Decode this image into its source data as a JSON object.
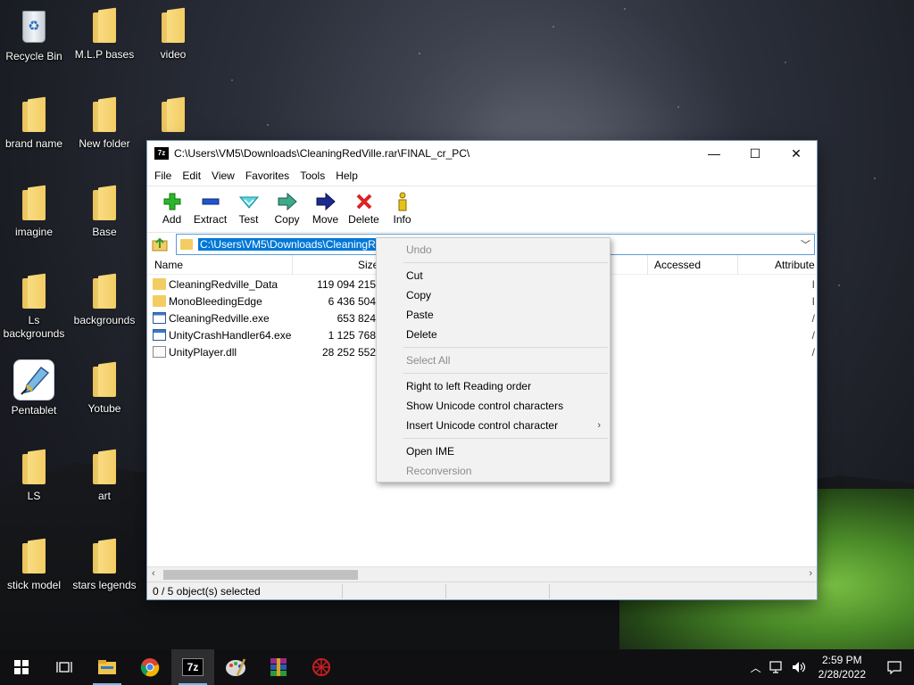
{
  "desktop": {
    "icons": [
      {
        "label": "Recycle Bin"
      },
      {
        "label": "M.L.P bases"
      },
      {
        "label": "video"
      },
      {
        "label": "brand name"
      },
      {
        "label": "New folder"
      },
      {
        "label": ""
      },
      {
        "label": "imagine"
      },
      {
        "label": "Base"
      },
      {
        "label": "Ls backgrounds"
      },
      {
        "label": "backgrounds"
      },
      {
        "label": "Pentablet"
      },
      {
        "label": "Yotube"
      },
      {
        "label": "LS"
      },
      {
        "label": "art"
      },
      {
        "label": "stick  model"
      },
      {
        "label": "stars legends"
      }
    ]
  },
  "window": {
    "title": "C:\\Users\\VM5\\Downloads\\CleaningRedVille.rar\\FINAL_cr_PC\\",
    "app_icon_text": "7z",
    "controls": {
      "minimize": "—",
      "maximize": "☐",
      "close": "✕"
    },
    "menu": [
      "File",
      "Edit",
      "View",
      "Favorites",
      "Tools",
      "Help"
    ],
    "toolbar": [
      {
        "label": "Add",
        "icon": "add-icon",
        "color": "#22aa22"
      },
      {
        "label": "Extract",
        "icon": "extract-icon",
        "color": "#2255cc"
      },
      {
        "label": "Test",
        "icon": "test-icon",
        "color": "#22b5c8"
      },
      {
        "label": "Copy",
        "icon": "copy-icon",
        "color": "#2a8a6a"
      },
      {
        "label": "Move",
        "icon": "move-icon",
        "color": "#1a2a8a"
      },
      {
        "label": "Delete",
        "icon": "delete-icon",
        "color": "#dd2222"
      },
      {
        "label": "Info",
        "icon": "info-icon",
        "color": "#ccaa11"
      }
    ],
    "address": {
      "value": "C:\\Users\\VM5\\Downloads\\CleaningRedVille.rar\\FINAL_cr_PC\\"
    },
    "columns": {
      "name": "Name",
      "size": "Size",
      "accessed": "Accessed",
      "attributes": "Attribute"
    },
    "files": [
      {
        "name": "CleaningRedville_Data",
        "size": "119 094 215",
        "type": "folder",
        "attr": "I"
      },
      {
        "name": "MonoBleedingEdge",
        "size": "6 436 504",
        "type": "folder",
        "attr": "I"
      },
      {
        "name": "CleaningRedville.exe",
        "size": "653 824",
        "type": "exe",
        "attr": "/"
      },
      {
        "name": "UnityCrashHandler64.exe",
        "size": "1 125 768",
        "type": "exe",
        "attr": "/"
      },
      {
        "name": "UnityPlayer.dll",
        "size": "28 252 552",
        "type": "dll",
        "attr": "/"
      }
    ],
    "status": "0 / 5 object(s) selected"
  },
  "context_menu": {
    "items": [
      {
        "label": "Undo",
        "disabled": true
      },
      {
        "sep": true
      },
      {
        "label": "Cut",
        "disabled": false
      },
      {
        "label": "Copy",
        "disabled": false
      },
      {
        "label": "Paste",
        "disabled": false
      },
      {
        "label": "Delete",
        "disabled": false
      },
      {
        "sep": true
      },
      {
        "label": "Select All",
        "disabled": true
      },
      {
        "sep": true
      },
      {
        "label": "Right to left Reading order",
        "disabled": false
      },
      {
        "label": "Show Unicode control characters",
        "disabled": false
      },
      {
        "label": "Insert Unicode control character",
        "disabled": false,
        "submenu": true
      },
      {
        "sep": true
      },
      {
        "label": "Open IME",
        "disabled": false
      },
      {
        "label": "Reconversion",
        "disabled": true
      }
    ]
  },
  "taskbar": {
    "apps": [
      "start",
      "task-view",
      "file-explorer",
      "chrome",
      "7zip",
      "paint-app",
      "winrar",
      "red-app"
    ],
    "clock": {
      "time": "2:59 PM",
      "date": "2/28/2022"
    }
  }
}
